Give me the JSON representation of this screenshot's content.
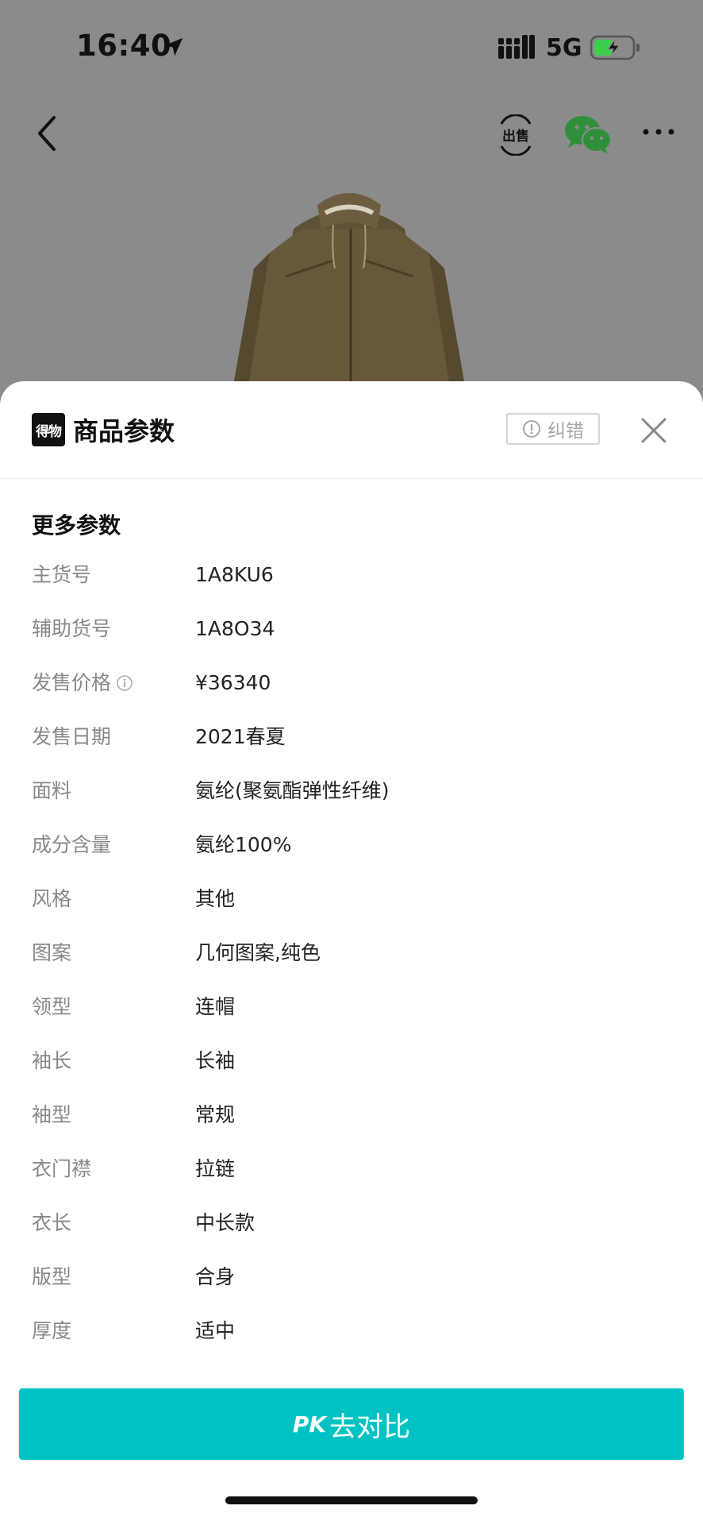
{
  "status_bar": {
    "time": "16:40",
    "network": "5G"
  },
  "nav": {
    "icons": [
      "back-icon",
      "sell-icon",
      "wechat-icon",
      "more-icon"
    ],
    "sell_icon_text": "出售"
  },
  "sheet": {
    "logo_text": "得物",
    "title": "商品参数",
    "report_label": "纠错",
    "section_title": "更多参数",
    "params": [
      {
        "label": "主货号",
        "value": "1A8KU6"
      },
      {
        "label": "辅助货号",
        "value": "1A8O34"
      },
      {
        "label": "发售价格",
        "value": "¥36340",
        "info": true
      },
      {
        "label": "发售日期",
        "value": "2021春夏"
      },
      {
        "label": "面料",
        "value": "氨纶(聚氨酯弹性纤维)"
      },
      {
        "label": "成分含量",
        "value": "氨纶100%"
      },
      {
        "label": "风格",
        "value": "其他"
      },
      {
        "label": "图案",
        "value": "几何图案,纯色"
      },
      {
        "label": "领型",
        "value": "连帽"
      },
      {
        "label": "袖长",
        "value": "长袖"
      },
      {
        "label": "袖型",
        "value": "常规"
      },
      {
        "label": "衣门襟",
        "value": "拉链"
      },
      {
        "label": "衣长",
        "value": "中长款"
      },
      {
        "label": "版型",
        "value": "合身"
      },
      {
        "label": "厚度",
        "value": "适中"
      }
    ],
    "pk_prefix": "PK",
    "pk_label": "去对比"
  },
  "colors": {
    "accent": "#01c2c3",
    "overlay": "#8b8b8b",
    "wechat": "#2f8f3b"
  }
}
